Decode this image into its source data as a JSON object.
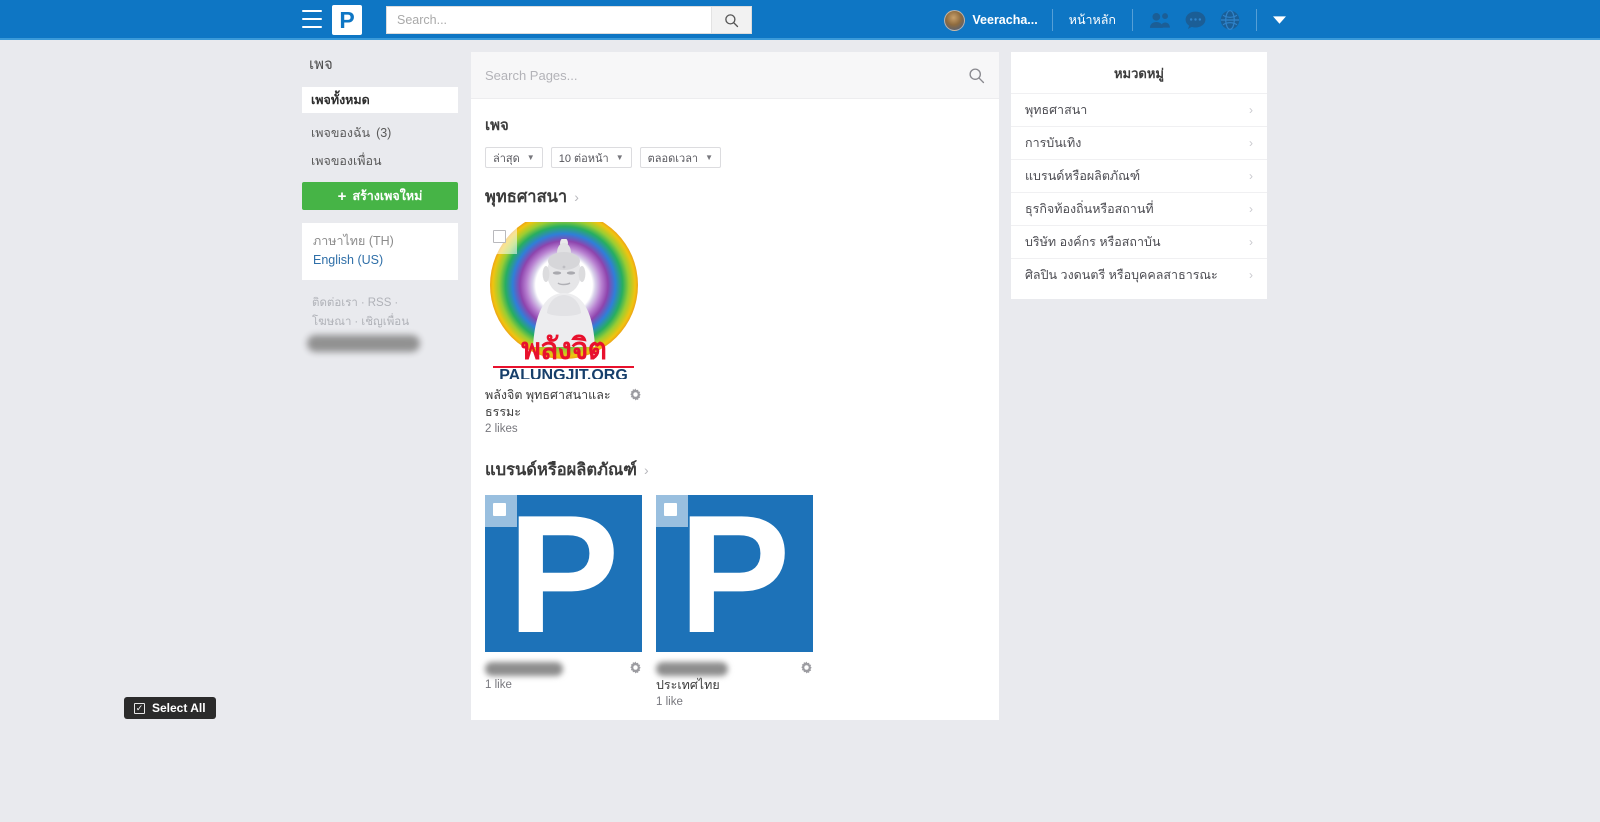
{
  "topnav": {
    "logo_letter": "P",
    "search_placeholder": "Search...",
    "user_name": "Veeracha...",
    "home_link": "หน้าหลัก",
    "icons": [
      "friends-icon",
      "messages-icon",
      "notifications-icon",
      "chevron-down-icon"
    ]
  },
  "sidebar": {
    "title": "เพจ",
    "items": [
      {
        "label": "เพจทั้งหมด",
        "count": "",
        "active": true
      },
      {
        "label": "เพจของฉัน",
        "count": "(3)",
        "active": false
      },
      {
        "label": "เพจของเพื่อน",
        "count": "",
        "active": false
      }
    ],
    "create_button": "สร้างเพจใหม่",
    "languages": [
      {
        "label": "ภาษาไทย (TH)",
        "selected": false
      },
      {
        "label": "English (US)",
        "selected": true
      }
    ],
    "footer_links": [
      "ติดต่อเรา",
      "RSS",
      "โฆษณา",
      "เชิญเพื่อน"
    ]
  },
  "main": {
    "search_placeholder": "Search Pages...",
    "title": "เพจ",
    "filters": [
      {
        "label": "ล่าสุด"
      },
      {
        "label": "10 ต่อหน้า"
      },
      {
        "label": "ตลอดเวลา"
      }
    ],
    "sections": [
      {
        "heading": "พุทธศาสนา",
        "cards": [
          {
            "name": "พลังจิต พุทธศาสนาและธรรมะ",
            "name_redacted": false,
            "likes": "2 likes",
            "thumb": "buddha-rainbow-logo",
            "thumb_text_main": "พลังจิต",
            "thumb_text_sub": "PALUNGJIT.ORG"
          }
        ]
      },
      {
        "heading": "แบรนด์หรือผลิตภัณฑ์",
        "cards": [
          {
            "name": "",
            "name_redacted": true,
            "likes": "1 like",
            "thumb": "p-letter-logo"
          },
          {
            "name": "ประเทศไทย",
            "name_redacted": true,
            "likes": "1 like",
            "thumb": "p-letter-logo"
          }
        ]
      }
    ]
  },
  "right": {
    "title": "หมวดหมู่",
    "categories": [
      "พุทธศาสนา",
      "การบันเทิง",
      "แบรนด์หรือผลิตภัณฑ์",
      "ธุรกิจท้องถิ่นหรือสถานที่",
      "บริษัท องค์กร หรือสถาบัน",
      "ศิลปิน วงดนตรี หรือบุคคลสาธารณะ"
    ]
  },
  "select_all": {
    "label": "Select All",
    "check_glyph": "✓"
  },
  "colors": {
    "nav_blue": "#0e76c4",
    "nav_border": "#3a9ad9",
    "page_bg": "#e9eaee",
    "create_green": "#46b446",
    "link_blue": "#2f6fa8",
    "logo_blue": "#1d72b8",
    "accent_red": "#e8112d"
  }
}
